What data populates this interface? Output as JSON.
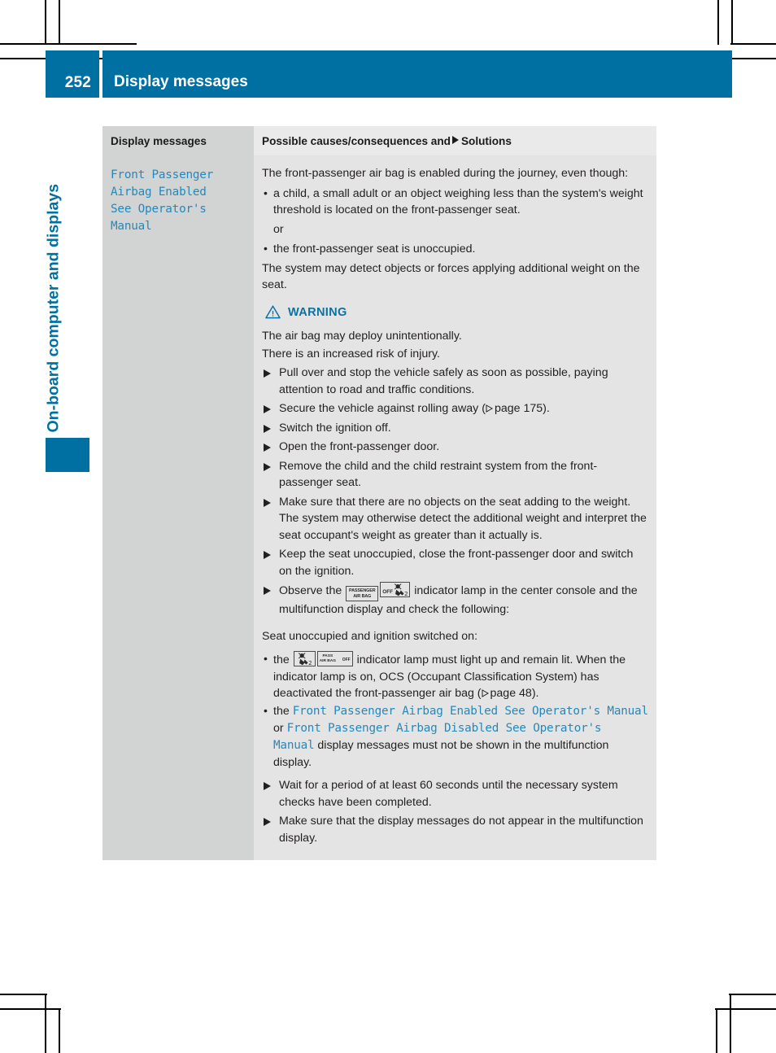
{
  "header": {
    "page_number": "252",
    "title": "Display messages"
  },
  "chapter": {
    "label": "On-board computer and displays"
  },
  "table": {
    "columns": {
      "left": "Display messages",
      "right_before": "Possible causes/consequences and",
      "right_after": "Solutions"
    },
    "row": {
      "message_lines": [
        "Front Passenger",
        "Airbag Enabled",
        "See Operator's",
        "Manual"
      ],
      "intro": "The front-passenger air bag is enabled during the journey, even though:",
      "causes": [
        "a child, a small adult or an object weighing less than the system's weight threshold is located on the front-passenger seat.",
        "the front-passenger seat is unoccupied."
      ],
      "or_word": "or",
      "after_causes": "The system may detect objects or forces applying additional weight on the seat.",
      "warning": {
        "title": "WARNING",
        "lines": [
          "The air bag may deploy unintentionally.",
          "There is an increased risk of injury."
        ]
      },
      "steps": [
        {
          "text": "Pull over and stop the vehicle safely as soon as possible, paying attention to road and traffic conditions."
        },
        {
          "text_before_ref": "Secure the vehicle against rolling away (",
          "ref_label": "page 175",
          "text_after_ref": ")."
        },
        {
          "text": "Switch the ignition off."
        },
        {
          "text": "Open the front-passenger door."
        },
        {
          "text": "Remove the child and the child restraint system from the front-passenger seat."
        },
        {
          "text": "Make sure that there are no objects on the seat adding to the weight.",
          "continuation": "The system may otherwise detect the additional weight and interpret the seat occupant's weight as greater than it actually is."
        },
        {
          "text": "Keep the seat unoccupied, close the front-passenger door and switch on the ignition."
        },
        {
          "observe_before": "Observe the",
          "observe_after": "indicator lamp in the center console and the multifunction display and check the following:"
        }
      ],
      "seat_note": "Seat unoccupied and ignition switched on:",
      "checks": [
        {
          "before": "the",
          "after_before_ref": "indicator lamp must light up and remain lit. When the indicator lamp is on, OCS (Occupant Classification System) has deactivated the front-passenger air bag (",
          "ref_label": "page 48",
          "after_ref": ")."
        },
        {
          "before": "the",
          "msg1": "Front Passenger Airbag Enabled See Operator's Manual",
          "conjunction": "or",
          "msg2": "Front Passenger Airbag Disabled See Operator's Manual",
          "after": "display messages must not be shown in the multifunction display."
        }
      ],
      "final_steps": [
        {
          "text": "Wait for a period of at least 60 seconds until the necessary system checks have been completed."
        },
        {
          "text": "Make sure that the display messages do not appear in the multifunction display."
        }
      ]
    }
  },
  "icons": {
    "passenger_air_bag_line1": "PASSENGER",
    "passenger_air_bag_line2": "AIR BAG",
    "off_label": "OFF",
    "pass_line1": "PASS",
    "pass_line2": "AIR BAG",
    "pass_off": "OFF"
  },
  "colors": {
    "brand_blue": "#0070a3",
    "message_blue": "#2389bd",
    "warning_blue": "#0c72a3",
    "header_cell_left": "#d2d3d3",
    "header_cell_right": "#eaeaea",
    "body_cell_right": "#e4e4e4"
  }
}
